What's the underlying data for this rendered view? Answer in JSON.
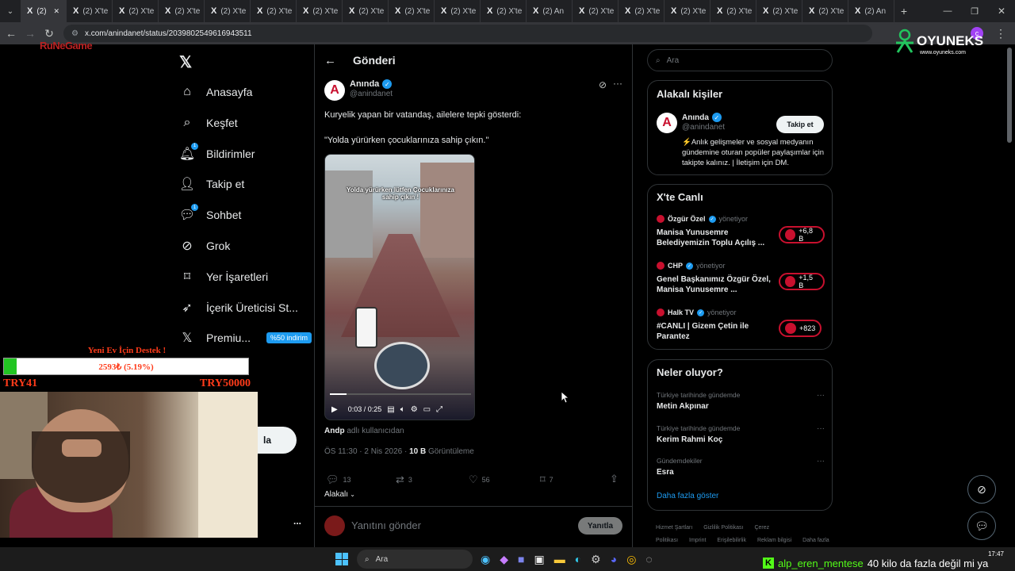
{
  "browser": {
    "tabs": [
      {
        "label": "(2)",
        "active": true
      },
      {
        "label": "(2) X'te"
      },
      {
        "label": "(2) X'te"
      },
      {
        "label": "(2) X'te"
      },
      {
        "label": "(2) X'te"
      },
      {
        "label": "(2) X'te"
      },
      {
        "label": "(2) X'te"
      },
      {
        "label": "(2) X'te"
      },
      {
        "label": "(2) X'te"
      },
      {
        "label": "(2) X'te"
      },
      {
        "label": "(2) X'te"
      },
      {
        "label": "(2) An"
      },
      {
        "label": "(2) X'te"
      },
      {
        "label": "(2) X'te"
      },
      {
        "label": "(2) X'te"
      },
      {
        "label": "(2) X'te"
      },
      {
        "label": "(2) X'te"
      },
      {
        "label": "(2) X'te"
      },
      {
        "label": "(2) An"
      }
    ],
    "url": "x.com/anindanet/status/2039802549616943511"
  },
  "overlay": {
    "topleft_logo": "RuNeGame",
    "oyuneks_logo": "OYUNEKS",
    "oyuneks_url": "www.oyuneks.com",
    "donation_title": "Yeni Ev İçin Destek !",
    "donation_progress_text": "2593₺ (5.19%)",
    "donation_progress": 0.0519,
    "donation_min": "TRY41",
    "donation_max": "TRY50000",
    "ticker_user": "alp_eren_mentese",
    "ticker_text": "40 kilo da fazla değil mi ya",
    "clock": "17:47"
  },
  "sidebar": {
    "items": [
      {
        "label": "Anasayfa",
        "icon": "home-icon"
      },
      {
        "label": "Keşfet",
        "icon": "search-icon"
      },
      {
        "label": "Bildirimler",
        "icon": "bell-icon",
        "dot": "1"
      },
      {
        "label": "Takip et",
        "icon": "add-user-icon"
      },
      {
        "label": "Sohbet",
        "icon": "chat-icon",
        "dot": "1"
      },
      {
        "label": "Grok",
        "icon": "grok-icon"
      },
      {
        "label": "Yer İşaretleri",
        "icon": "bookmark-icon"
      },
      {
        "label": "İçerik Üreticisi St...",
        "icon": "rocket-icon"
      },
      {
        "label": "Premiu...",
        "icon": "x-icon",
        "badge": "%50 indirim"
      }
    ],
    "post_button_partial": "la",
    "more": "..."
  },
  "main": {
    "header_title": "Gönderi",
    "author_name": "Anında",
    "author_handle": "@anindanet",
    "text_line1": "Kuryelik yapan bir vatandaş, ailelere tepki gösterdi:",
    "text_line2": "\"Yolda yürürken çocuklarınıza sahip çıkın.\"",
    "video_caption": "Yolda yürürken lütfen Çocuklarınıza sahip çıkın !",
    "video_time": "0:03 / 0:25",
    "video_progress": 0.12,
    "credit_user": "Andp",
    "credit_suffix": "adlı kullanıcıdan",
    "timestamp": "ÖS 11:30 · 2 Nis 2026 ·",
    "views_count": "10 B",
    "views_label": "Görüntüleme",
    "replies": "13",
    "reposts": "3",
    "likes": "56",
    "bookmarks": "7",
    "relevance": "Alakalı",
    "reply_placeholder": "Yanıtını gönder",
    "reply_button": "Yanıtla"
  },
  "right": {
    "search_placeholder": "Ara",
    "related_title": "Alakalı kişiler",
    "related_name": "Anında",
    "related_handle": "@anindanet",
    "follow_button": "Takip et",
    "related_bio": "⚡Anlık gelişmeler ve sosyal medyanın gündemine oturan popüler paylaşımlar için takipte kalınız. | İletişim için DM.",
    "live_title": "X'te Canlı",
    "live": [
      {
        "host": "Özgür Özel",
        "role": "yönetiyor",
        "title": "Manisa Yunusemre Belediyemizin Toplu Açılış ...",
        "count": "+6,8 B"
      },
      {
        "host": "CHP",
        "role": "yönetiyor",
        "title": "Genel Başkanımız Özgür Özel, Manisa Yunusemre ...",
        "count": "+1,5 B"
      },
      {
        "host": "Halk TV",
        "role": "yönetiyor",
        "title": "#CANLI | Gizem Çetin ile Parantez",
        "count": "+823"
      }
    ],
    "trends_title": "Neler oluyor?",
    "trends": [
      {
        "context": "Türkiye tarihinde gündemde",
        "name": "Metin Akpınar"
      },
      {
        "context": "Türkiye tarihinde gündemde",
        "name": "Kerim Rahmi Koç"
      },
      {
        "context": "Gündemdekiler",
        "name": "Esra"
      }
    ],
    "show_more": "Daha fazla göster",
    "footer": [
      "Hizmet Şartları",
      "Gizlilik Politikası",
      "Çerez Politikası",
      "Imprint",
      "Erişilebilirlik",
      "Reklam bilgisi",
      "Daha fazla ..."
    ]
  },
  "taskbar": {
    "search_placeholder": "Ara"
  },
  "colors": {
    "accent": "#1d9bf0",
    "live_red": "#c8102e",
    "progress_green": "#22c522"
  }
}
